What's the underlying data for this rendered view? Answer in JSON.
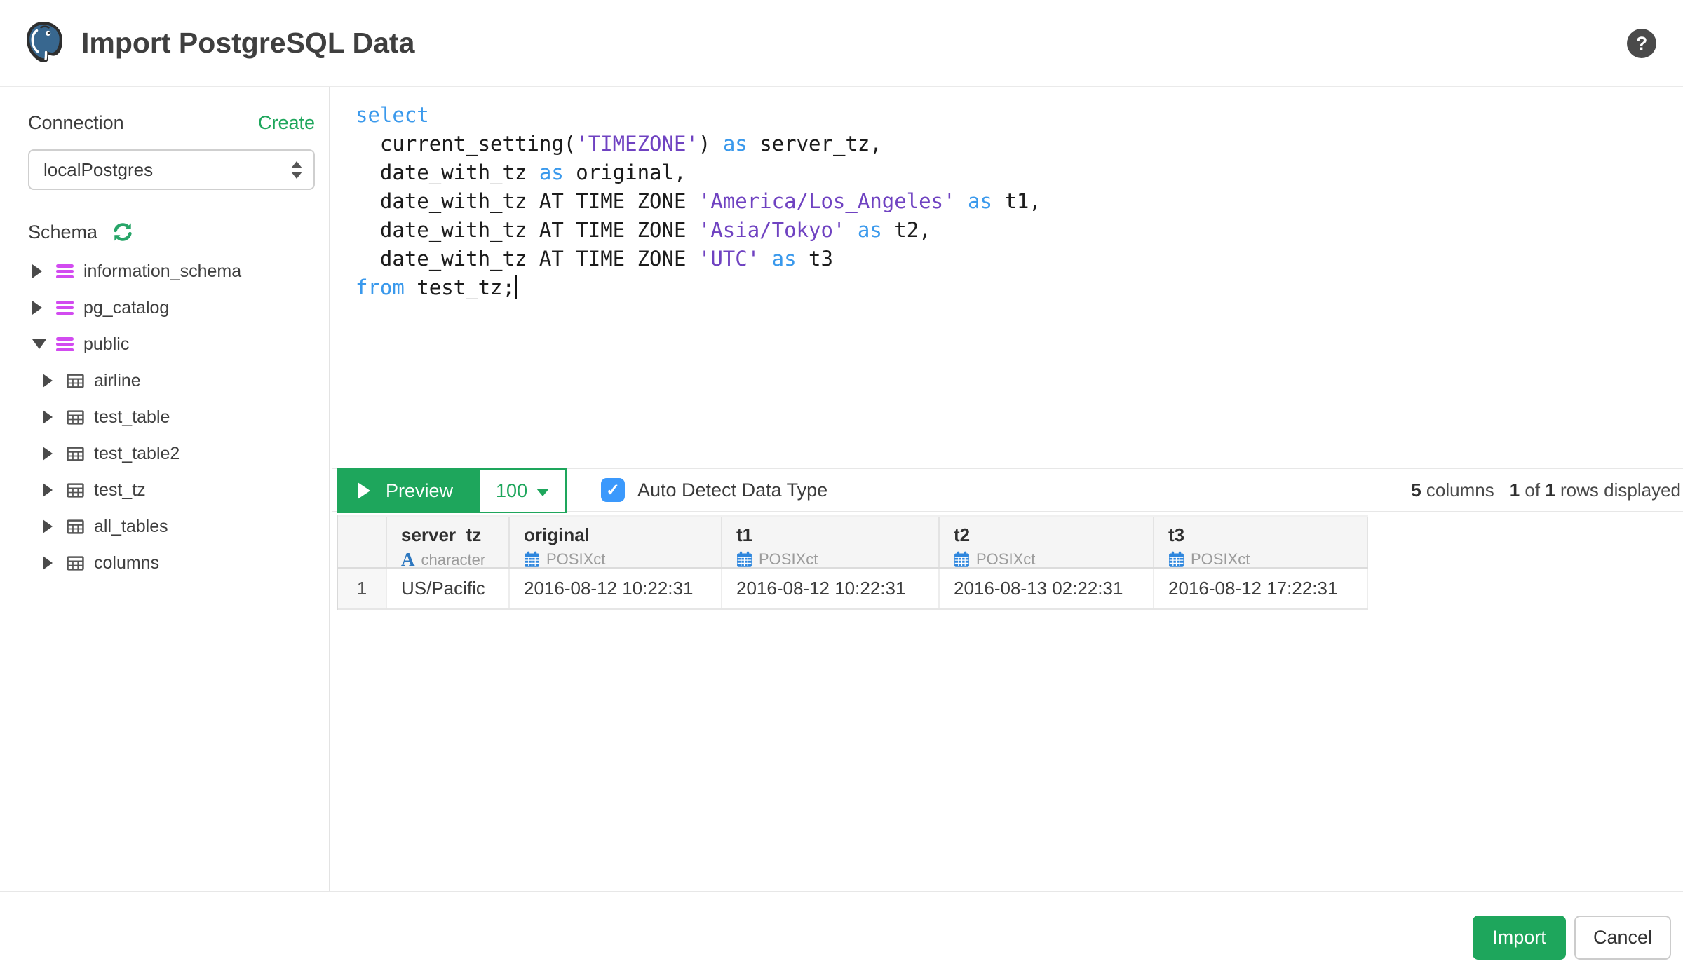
{
  "header": {
    "title": "Import PostgreSQL Data",
    "help": "?"
  },
  "sidebar": {
    "connection_label": "Connection",
    "create_link": "Create",
    "connection_value": "localPostgres",
    "schema_label": "Schema",
    "tree": [
      {
        "label": "information_schema",
        "type": "schema",
        "expanded": false,
        "level": 1
      },
      {
        "label": "pg_catalog",
        "type": "schema",
        "expanded": false,
        "level": 1
      },
      {
        "label": "public",
        "type": "schema",
        "expanded": true,
        "level": 1
      },
      {
        "label": "airline",
        "type": "table",
        "expanded": false,
        "level": 2
      },
      {
        "label": "test_table",
        "type": "table",
        "expanded": false,
        "level": 2
      },
      {
        "label": "test_table2",
        "type": "table",
        "expanded": false,
        "level": 2
      },
      {
        "label": "test_tz",
        "type": "table",
        "expanded": false,
        "level": 2
      },
      {
        "label": "all_tables",
        "type": "table",
        "expanded": false,
        "level": 2
      },
      {
        "label": "columns",
        "type": "table",
        "expanded": false,
        "level": 2
      }
    ]
  },
  "editor": {
    "code": [
      [
        [
          "k",
          "select"
        ]
      ],
      [
        [
          "p",
          "  current_setting("
        ],
        [
          "s",
          "'TIMEZONE'"
        ],
        [
          "p",
          ") "
        ],
        [
          "k",
          "as"
        ],
        [
          "p",
          " server_tz,"
        ]
      ],
      [
        [
          "p",
          "  date_with_tz "
        ],
        [
          "k",
          "as"
        ],
        [
          "p",
          " original,"
        ]
      ],
      [
        [
          "p",
          "  date_with_tz AT TIME ZONE "
        ],
        [
          "s",
          "'America/Los_Angeles'"
        ],
        [
          "p",
          " "
        ],
        [
          "k",
          "as"
        ],
        [
          "p",
          " t1,"
        ]
      ],
      [
        [
          "p",
          "  date_with_tz AT TIME ZONE "
        ],
        [
          "s",
          "'Asia/Tokyo'"
        ],
        [
          "p",
          " "
        ],
        [
          "k",
          "as"
        ],
        [
          "p",
          " t2,"
        ]
      ],
      [
        [
          "p",
          "  date_with_tz AT TIME ZONE "
        ],
        [
          "s",
          "'UTC'"
        ],
        [
          "p",
          " "
        ],
        [
          "k",
          "as"
        ],
        [
          "p",
          " t3"
        ]
      ],
      [
        [
          "k",
          "from"
        ],
        [
          "p",
          " test_tz;"
        ],
        [
          "caret",
          ""
        ]
      ]
    ]
  },
  "toolbar": {
    "preview_label": "Preview",
    "row_limit": "100",
    "auto_detect_label": "Auto Detect Data Type",
    "checkbox_checked": true,
    "check_glyph": "✓",
    "column_count": "5",
    "columns_label": " columns",
    "rows_shown": "1",
    "of_label": " of ",
    "rows_total": "1",
    "rows_label": " rows displayed"
  },
  "table": {
    "columns": [
      {
        "name": "server_tz",
        "type": "character",
        "icon": "character-type-icon"
      },
      {
        "name": "original",
        "type": "POSIXct",
        "icon": "calendar-type-icon"
      },
      {
        "name": "t1",
        "type": "POSIXct",
        "icon": "calendar-type-icon"
      },
      {
        "name": "t2",
        "type": "POSIXct",
        "icon": "calendar-type-icon"
      },
      {
        "name": "t3",
        "type": "POSIXct",
        "icon": "calendar-type-icon"
      }
    ],
    "rows": [
      {
        "num": "1",
        "values": [
          "US/Pacific",
          "2016-08-12 10:22:31",
          "2016-08-12 10:22:31",
          "2016-08-13 02:22:31",
          "2016-08-12 17:22:31"
        ]
      }
    ]
  },
  "footer": {
    "import_label": "Import",
    "cancel_label": "Cancel"
  },
  "colors": {
    "accent_green": "#1ea65c",
    "checkbox_blue": "#3b99fc",
    "keyword_blue": "#3a99ec",
    "string_purple": "#6f42c1",
    "schema_magenta": "#d24bf0",
    "type_icon_blue": "#2e86dd",
    "header_gray": "#f5f5f5"
  }
}
